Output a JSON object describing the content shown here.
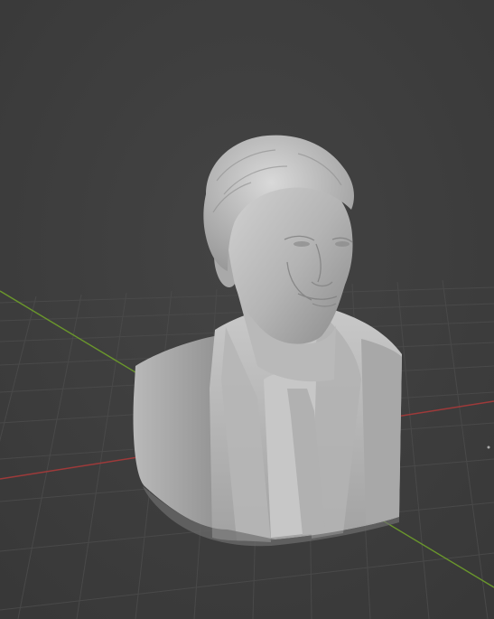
{
  "viewport": {
    "background_color": "#3d3d3d",
    "grid_color": "#4a4a4a",
    "x_axis_color": "#a23b3b",
    "y_axis_color": "#6a9a2a",
    "model_base_color": "#bdbdbd",
    "model_shadow_color": "#7c7c7c",
    "model_highlight_color": "#d8d8d8",
    "model_icon": "sculpted-bust",
    "floor_grid_visible": true,
    "axis_lines_visible": [
      "x",
      "y"
    ]
  }
}
